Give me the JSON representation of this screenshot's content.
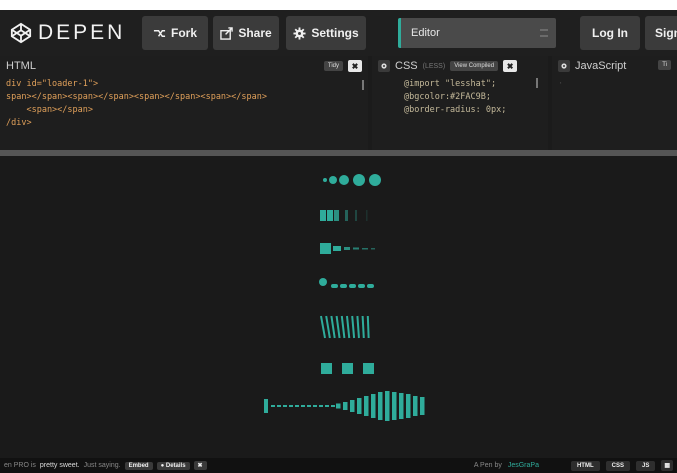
{
  "colors": {
    "accent": "#2FAC9B",
    "topbar_bg": "#1f1f1f",
    "button_bg": "#3b3b3b",
    "preview_bg": "#1a1a1a"
  },
  "header": {
    "logo_text": "DEPEN",
    "fork_label": "Fork",
    "share_label": "Share",
    "settings_label": "Settings",
    "editor_value": "Editor",
    "login_label": "Log In",
    "signup_label": "Sign"
  },
  "panes": {
    "html": {
      "title": "HTML",
      "tidy_label": "Tidy",
      "close_label": "✖",
      "lines": [
        "div id=\"loader-1\">",
        "span></span><span></span><span></span><span></span>",
        "    <span></span>",
        "/div>"
      ]
    },
    "css": {
      "title": "CSS",
      "subtitle": "(LESS)",
      "view_compiled_label": "View Compiled",
      "close_label": "✖",
      "lines": [
        "@import \"lesshat\";",
        "",
        "@bgcolor:#2FAC9B;",
        "@border-radius: 0px;"
      ]
    },
    "js": {
      "title": "JavaScript",
      "tidy_label": "Ti"
    }
  },
  "footer": {
    "promo_prefix": "en PRO is",
    "promo_bold": "pretty sweet.",
    "promo_suffix": "Just saying.",
    "embed_label": "Embed",
    "details_label": "● Details",
    "close_label": "✖",
    "pen_by": "A Pen by",
    "author": "JesGraPa",
    "tab_html": "HTML",
    "tab_css": "CSS",
    "tab_js": "JS"
  },
  "loaders": [
    {
      "name": "dots-growing",
      "type": "dots",
      "sizes": [
        2,
        4,
        5,
        6,
        6
      ]
    },
    {
      "name": "bars-fading",
      "type": "fade-bars",
      "opacity": [
        1,
        1,
        0.8,
        0.5,
        0.3,
        0.15
      ]
    },
    {
      "name": "square-dashes",
      "type": "square-dashes"
    },
    {
      "name": "dot-pills",
      "type": "pills"
    },
    {
      "name": "slanted-lines",
      "type": "slanted"
    },
    {
      "name": "three-squares",
      "type": "squares"
    },
    {
      "name": "bars-wave",
      "type": "wave"
    }
  ]
}
